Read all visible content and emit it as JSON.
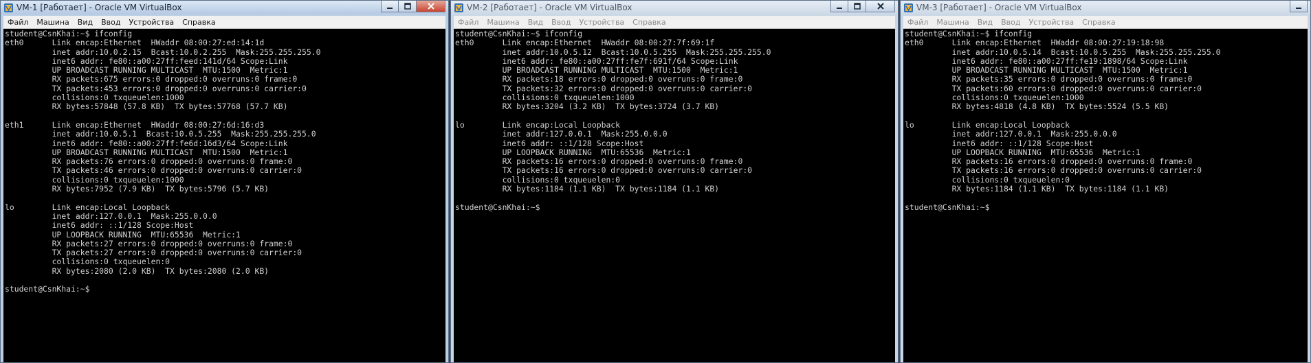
{
  "windows": [
    {
      "title": "VM-1 [Работает] - Oracle VM VirtualBox",
      "menu": [
        "Файл",
        "Машина",
        "Вид",
        "Ввод",
        "Устройства",
        "Справка"
      ],
      "terminal": "student@CsnKhai:~$ ifconfig\neth0      Link encap:Ethernet  HWaddr 08:00:27:ed:14:1d\n          inet addr:10.0.2.15  Bcast:10.0.2.255  Mask:255.255.255.0\n          inet6 addr: fe80::a00:27ff:feed:141d/64 Scope:Link\n          UP BROADCAST RUNNING MULTICAST  MTU:1500  Metric:1\n          RX packets:675 errors:0 dropped:0 overruns:0 frame:0\n          TX packets:453 errors:0 dropped:0 overruns:0 carrier:0\n          collisions:0 txqueuelen:1000\n          RX bytes:57848 (57.8 KB)  TX bytes:57768 (57.7 KB)\n\neth1      Link encap:Ethernet  HWaddr 08:00:27:6d:16:d3\n          inet addr:10.0.5.1  Bcast:10.0.5.255  Mask:255.255.255.0\n          inet6 addr: fe80::a00:27ff:fe6d:16d3/64 Scope:Link\n          UP BROADCAST RUNNING MULTICAST  MTU:1500  Metric:1\n          RX packets:76 errors:0 dropped:0 overruns:0 frame:0\n          TX packets:46 errors:0 dropped:0 overruns:0 carrier:0\n          collisions:0 txqueuelen:1000\n          RX bytes:7952 (7.9 KB)  TX bytes:5796 (5.7 KB)\n\nlo        Link encap:Local Loopback\n          inet addr:127.0.0.1  Mask:255.0.0.0\n          inet6 addr: ::1/128 Scope:Host\n          UP LOOPBACK RUNNING  MTU:65536  Metric:1\n          RX packets:27 errors:0 dropped:0 overruns:0 frame:0\n          TX packets:27 errors:0 dropped:0 overruns:0 carrier:0\n          collisions:0 txqueuelen:0\n          RX bytes:2080 (2.0 KB)  TX bytes:2080 (2.0 KB)\n\nstudent@CsnKhai:~$"
    },
    {
      "title": "VM-2 [Работает] - Oracle VM VirtualBox",
      "menu": [
        "Файл",
        "Машина",
        "Вид",
        "Ввод",
        "Устройства",
        "Справка"
      ],
      "terminal": "student@CsnKhai:~$ ifconfig\neth0      Link encap:Ethernet  HWaddr 08:00:27:7f:69:1f\n          inet addr:10.0.5.12  Bcast:10.0.5.255  Mask:255.255.255.0\n          inet6 addr: fe80::a00:27ff:fe7f:691f/64 Scope:Link\n          UP BROADCAST RUNNING MULTICAST  MTU:1500  Metric:1\n          RX packets:18 errors:0 dropped:0 overruns:0 frame:0\n          TX packets:32 errors:0 dropped:0 overruns:0 carrier:0\n          collisions:0 txqueuelen:1000\n          RX bytes:3204 (3.2 KB)  TX bytes:3724 (3.7 KB)\n\nlo        Link encap:Local Loopback\n          inet addr:127.0.0.1  Mask:255.0.0.0\n          inet6 addr: ::1/128 Scope:Host\n          UP LOOPBACK RUNNING  MTU:65536  Metric:1\n          RX packets:16 errors:0 dropped:0 overruns:0 frame:0\n          TX packets:16 errors:0 dropped:0 overruns:0 carrier:0\n          collisions:0 txqueuelen:0\n          RX bytes:1184 (1.1 KB)  TX bytes:1184 (1.1 KB)\n\nstudent@CsnKhai:~$"
    },
    {
      "title": "VM-3 [Работает] - Oracle VM VirtualBox",
      "menu": [
        "Файл",
        "Машина",
        "Вид",
        "Ввод",
        "Устройства",
        "Справка"
      ],
      "terminal": "student@CsnKhai:~$ ifconfig\neth0      Link encap:Ethernet  HWaddr 08:00:27:19:18:98\n          inet addr:10.0.5.14  Bcast:10.0.5.255  Mask:255.255.255.0\n          inet6 addr: fe80::a00:27ff:fe19:1898/64 Scope:Link\n          UP BROADCAST RUNNING MULTICAST  MTU:1500  Metric:1\n          RX packets:35 errors:0 dropped:0 overruns:0 frame:0\n          TX packets:60 errors:0 dropped:0 overruns:0 carrier:0\n          collisions:0 txqueuelen:1000\n          RX bytes:4818 (4.8 KB)  TX bytes:5524 (5.5 KB)\n\nlo        Link encap:Local Loopback\n          inet addr:127.0.0.1  Mask:255.0.0.0\n          inet6 addr: ::1/128 Scope:Host\n          UP LOOPBACK RUNNING  MTU:65536  Metric:1\n          RX packets:16 errors:0 dropped:0 overruns:0 frame:0\n          TX packets:16 errors:0 dropped:0 overruns:0 carrier:0\n          collisions:0 txqueuelen:0\n          RX bytes:1184 (1.1 KB)  TX bytes:1184 (1.1 KB)\n\nstudent@CsnKhai:~$"
    }
  ]
}
